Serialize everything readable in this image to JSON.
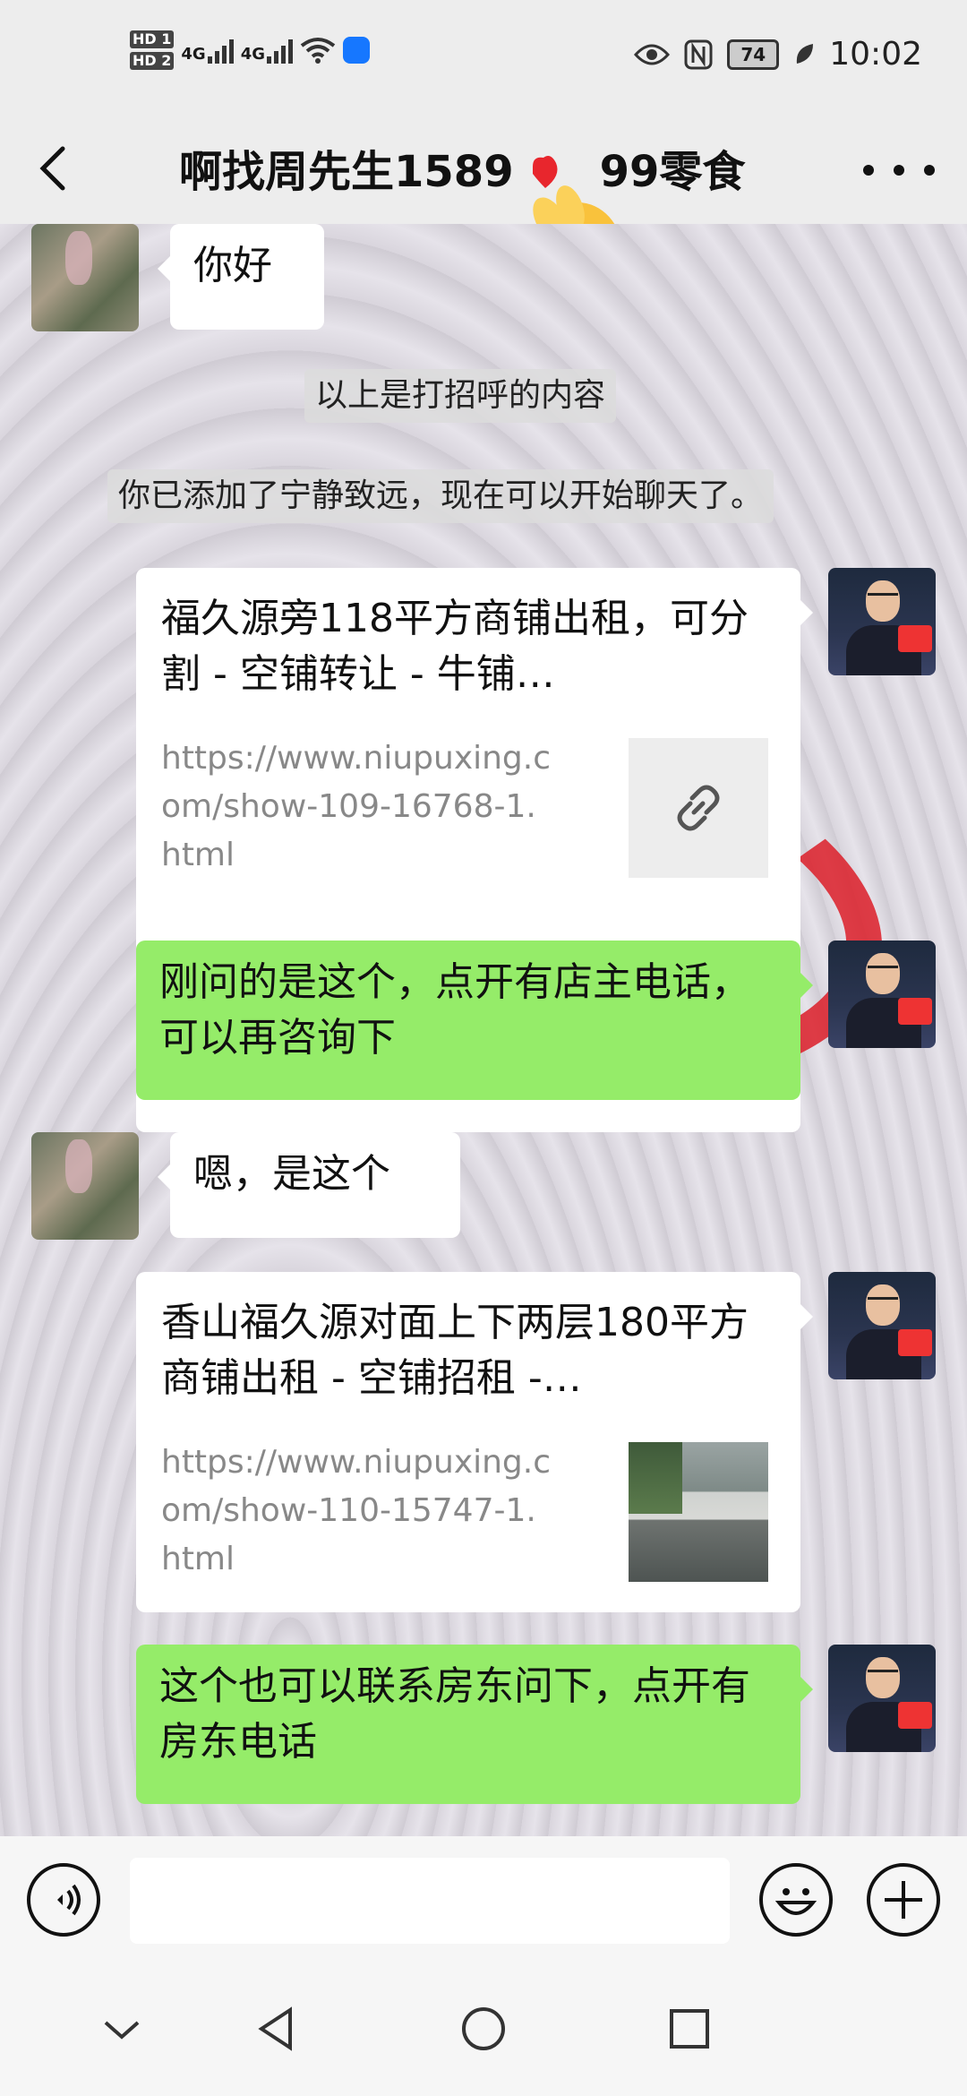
{
  "status_bar": {
    "sim1": "HD 1",
    "sim2": "HD 2",
    "net1": "4G",
    "net2": "4G",
    "battery": "74",
    "time": "10:02"
  },
  "header": {
    "title": "啊找周先生1589",
    "title_tail": "99零食"
  },
  "messages": {
    "m1": "你好",
    "sys1": "以上是打招呼的内容",
    "sys2": "你已添加了宁静致远，现在可以开始聊天了。",
    "card1": {
      "title": "福久源旁118平方商铺出租，可分割 - 空铺转让 - 牛铺…",
      "url": "https://www.niupuxing.com/show-109-16768-1.html"
    },
    "m2": "刚问的是这个，点开有店主电话，可以再咨询下",
    "m3": "嗯，是这个",
    "card2": {
      "title": "香山福久源对面上下两层180平方商铺出租 - 空铺招租 -…",
      "url": "https://www.niupuxing.com/show-110-15747-1.html"
    },
    "m4": "这个也可以联系房东问下，点开有房东电话"
  },
  "input": {
    "value": "",
    "placeholder": ""
  },
  "colors": {
    "bubble_green": "#95ec69",
    "bubble_white": "#ffffff",
    "header_bg": "#ededed"
  }
}
